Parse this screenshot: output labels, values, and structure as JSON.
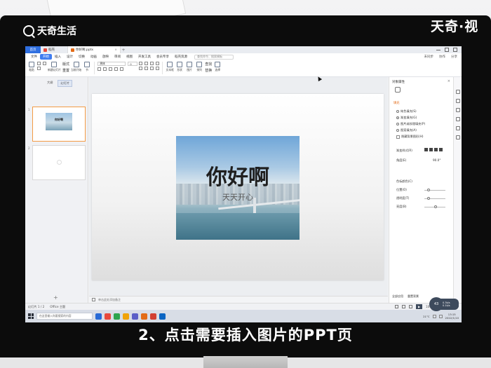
{
  "watermark": {
    "brand": "天奇生活"
  },
  "brand_right": "天奇·视",
  "caption": "2、点击需要插入图片的PPT页",
  "app": {
    "tabs": [
      {
        "label": "首页",
        "color": "#2f6fe0"
      },
      {
        "label": "稻壳",
        "color": "#e8493c"
      },
      {
        "label": "你好啊.pptx",
        "color": "#e36b17"
      }
    ],
    "menu": [
      "文件",
      "开始",
      "插入",
      "设计",
      "切换",
      "动画",
      "放映",
      "审阅",
      "视图",
      "开发工具",
      "会员专享",
      "稻壳资源"
    ],
    "menu_search": "查找命令、搜索模板",
    "menu_right": [
      "未同步",
      "协作",
      "分享"
    ]
  },
  "toolbar": {
    "groups": [
      "粘贴",
      "新建幻灯片",
      "版式",
      "重置",
      "当前开始",
      "节",
      "文本框",
      "形状",
      "图片",
      "排列",
      "查找",
      "替换",
      "选择"
    ],
    "font_select": "黑体",
    "size_select": "0"
  },
  "left_pane": {
    "tabs": [
      "大纲",
      "幻灯片"
    ],
    "active_tab": "幻灯片",
    "slides": [
      {
        "num": "1",
        "title": "你好啊"
      },
      {
        "num": "2",
        "title": ""
      }
    ],
    "add_symbol": "+"
  },
  "slide": {
    "title": "你好啊",
    "subtitle": "天天开心"
  },
  "notes_placeholder": "单击此处添加备注",
  "right_pane": {
    "title": "对象属性",
    "section": "填充",
    "options": [
      "纯色填充(S)",
      "渐变填充(G)",
      "图片或纹理填充(P)",
      "图案填充(A)",
      "隐藏背景图形(H)"
    ],
    "selected_option": "渐变填充(G)",
    "labels": [
      "渐变样式(R)",
      "角度(E)",
      "色标颜色(C)",
      "位置(O)",
      "透明度(T)",
      "亮度(B)"
    ],
    "angle_value": "90.0°",
    "bottom_tabs": [
      "全部应用",
      "重置背景"
    ]
  },
  "status": {
    "slide_info": "幻灯片 1 / 2",
    "theme": "Office 主题",
    "zoom": "100%"
  },
  "zoom_badge": "43",
  "zoom_pill": [
    "0.3k/s",
    "0.1k/s"
  ],
  "taskbar": {
    "search_placeholder": "在这里输入你要搜索的内容",
    "temperature": "21°C",
    "time": "13:15",
    "date": "2022/1/10",
    "app_colors": [
      "#2a6bd6",
      "#e8493c",
      "#2da44e",
      "#f0a30a",
      "#5b5fc7",
      "#e36b17",
      "#d23f31",
      "#0a64c2"
    ]
  }
}
